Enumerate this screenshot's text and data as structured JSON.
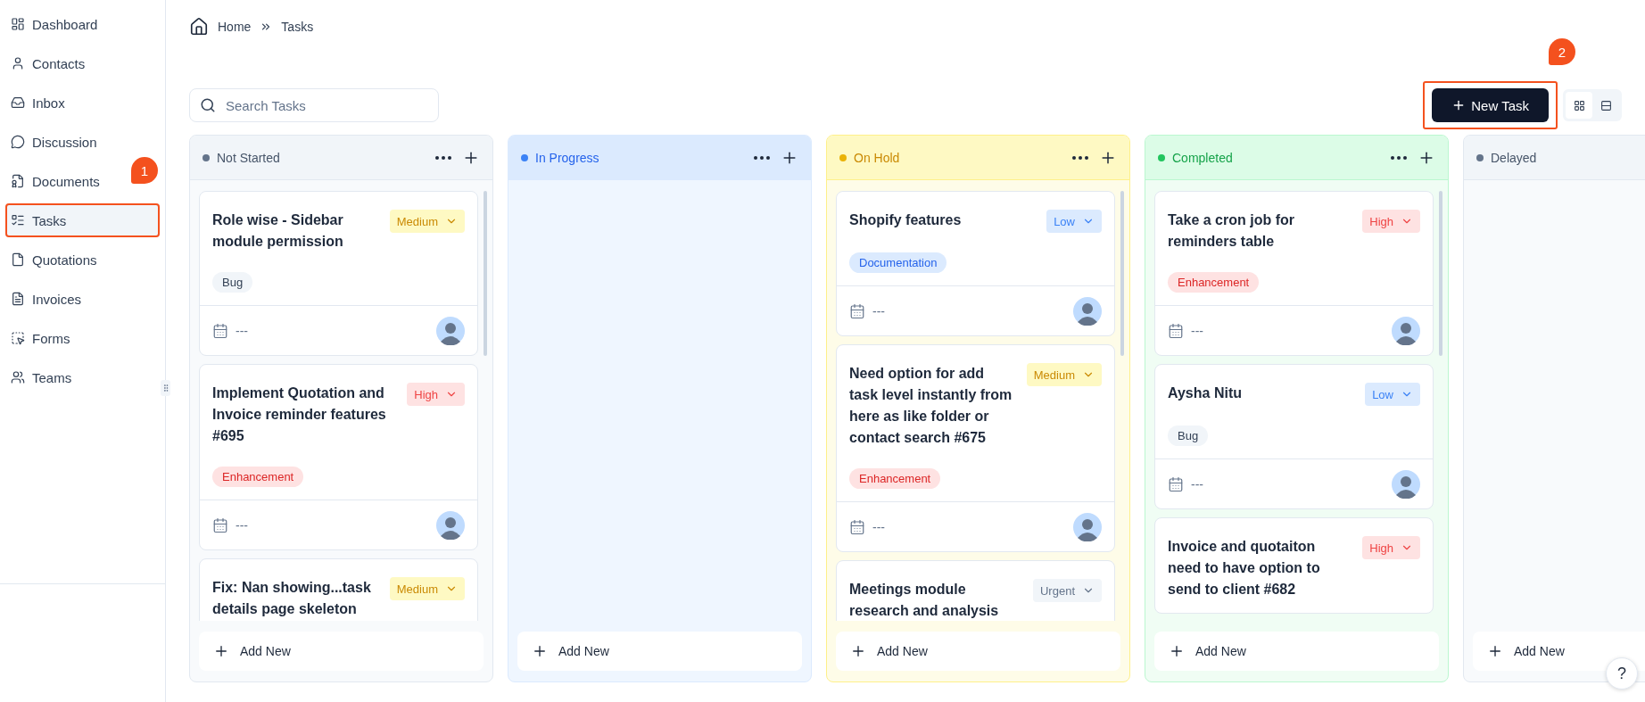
{
  "sidebar": {
    "items": [
      {
        "label": "Dashboard",
        "kind": "dashboard",
        "selected": false,
        "highlighted": false
      },
      {
        "label": "Contacts",
        "kind": "contacts",
        "selected": false,
        "highlighted": false
      },
      {
        "label": "Inbox",
        "kind": "inbox",
        "selected": false,
        "highlighted": false
      },
      {
        "label": "Discussion",
        "kind": "discussion",
        "selected": false,
        "highlighted": false
      },
      {
        "label": "Documents",
        "kind": "documents",
        "selected": false,
        "highlighted": false
      },
      {
        "label": "Tasks",
        "kind": "tasks",
        "selected": true,
        "highlighted": true,
        "callout": "1"
      },
      {
        "label": "Quotations",
        "kind": "quotations",
        "selected": false,
        "highlighted": false
      },
      {
        "label": "Invoices",
        "kind": "invoices",
        "selected": false,
        "highlighted": false
      },
      {
        "label": "Forms",
        "kind": "forms",
        "selected": false,
        "highlighted": false
      },
      {
        "label": "Teams",
        "kind": "teams",
        "selected": false,
        "highlighted": false
      }
    ]
  },
  "breadcrumb": [
    "Home",
    "Tasks"
  ],
  "search": {
    "placeholder": "Search Tasks"
  },
  "new_task_button": {
    "label": "New Task",
    "highlighted": true,
    "callout": "2"
  },
  "view_toggle": [
    {
      "kind": "board",
      "selected": true
    },
    {
      "kind": "list",
      "selected": false
    }
  ],
  "columns": [
    {
      "title": "Not Started",
      "kind": "slate",
      "color": "#64748b",
      "menu": true,
      "add_label": "Add New",
      "cards": [
        {
          "title": "Role wise - Sidebar module permission",
          "priority": {
            "label": "Medium",
            "kind": "medium"
          },
          "tag": {
            "label": "Bug",
            "kind": "bug"
          },
          "date": "---"
        },
        {
          "title": "Implement Quotation and Invoice reminder features #695",
          "priority": {
            "label": "High",
            "kind": "high"
          },
          "tag": {
            "label": "Enhancement",
            "kind": "enhancement"
          },
          "date": "---"
        },
        {
          "title": "Fix: Nan showing...task details page skeleton",
          "priority": {
            "label": "Medium",
            "kind": "medium"
          }
        }
      ]
    },
    {
      "title": "In Progress",
      "kind": "blue",
      "color": "#3b82f6",
      "menu": true,
      "add_label": "Add New"
    },
    {
      "title": "On Hold",
      "kind": "yellow",
      "color": "#eab308",
      "menu": true,
      "add_label": "Add New",
      "cards": [
        {
          "title": "Shopify features",
          "priority": {
            "label": "Low",
            "kind": "low"
          },
          "tag": {
            "label": "Documentation",
            "kind": "documentation"
          },
          "date": "---"
        },
        {
          "title": "Need option for add task level instantly from here as like folder or contact search #675",
          "priority": {
            "label": "Medium",
            "kind": "medium"
          },
          "tag": {
            "label": "Enhancement",
            "kind": "enhancement"
          },
          "date": "---"
        },
        {
          "title": "Meetings module research and analysis",
          "priority": {
            "label": "Urgent",
            "kind": "urgent"
          }
        }
      ]
    },
    {
      "title": "Completed",
      "kind": "green",
      "color": "#22c55e",
      "menu": true,
      "add_label": "Add New",
      "cards": [
        {
          "title": "Take a cron job for reminders table",
          "priority": {
            "label": "High",
            "kind": "high"
          },
          "tag": {
            "label": "Enhancement",
            "kind": "enhancement"
          },
          "date": "---"
        },
        {
          "title": "Aysha Nitu",
          "priority": {
            "label": "Low",
            "kind": "low"
          },
          "tag": {
            "label": "Bug",
            "kind": "bug"
          },
          "date": "---"
        },
        {
          "title": "Invoice and quotaiton need to have option to send to client #682",
          "priority": {
            "label": "High",
            "kind": "high"
          }
        }
      ]
    },
    {
      "title": "Delayed",
      "kind": "slate",
      "color": "#64748b",
      "add_label": "Add New"
    }
  ],
  "help_button": "?"
}
